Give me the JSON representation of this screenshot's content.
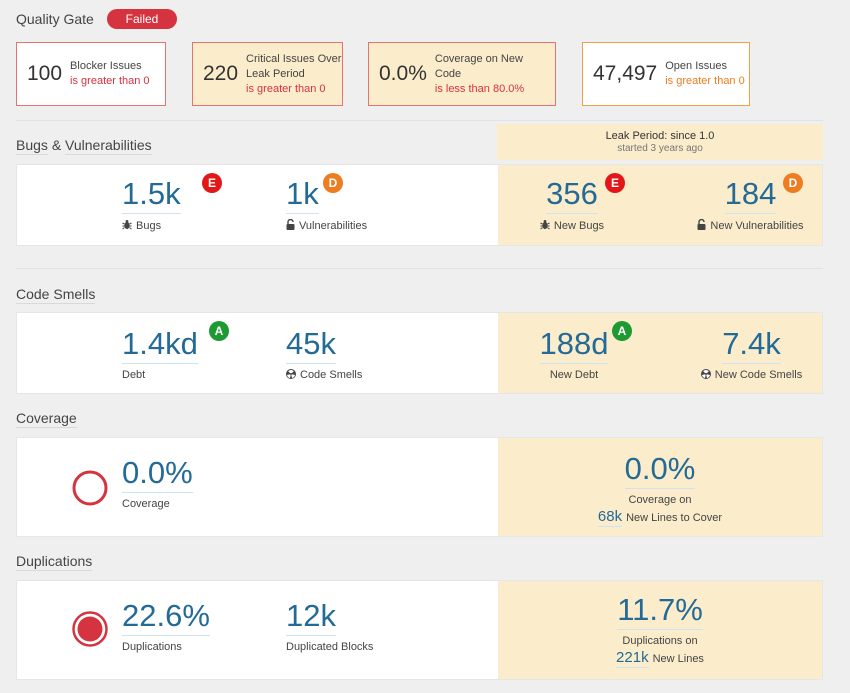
{
  "quality_gate": {
    "title": "Quality Gate",
    "status": "Failed",
    "conditions": [
      {
        "value": "100",
        "label": "Blocker Issues",
        "operator": "is greater than 0",
        "leak": false,
        "level": "error"
      },
      {
        "value": "220",
        "label": "Critical Issues Over Leak Period",
        "operator": "is greater than 0",
        "leak": true,
        "level": "error"
      },
      {
        "value": "0.0%",
        "label": "Coverage on New Code",
        "operator": "is less than 80.0%",
        "leak": true,
        "level": "error"
      },
      {
        "value": "47,497",
        "label": "Open Issues",
        "operator": "is greater than 0",
        "leak": false,
        "level": "warn"
      }
    ]
  },
  "leak_period": {
    "title": "Leak Period: since 1.0",
    "subtitle": "started 3 years ago"
  },
  "bugs_vulnerabilities": {
    "title_part1": "Bugs",
    "title_amp": "&",
    "title_part2": "Vulnerabilities",
    "bugs": {
      "value": "1.5k",
      "label": "Bugs",
      "rating": "E"
    },
    "vulnerabilities": {
      "value": "1k",
      "label": "Vulnerabilities",
      "rating": "D"
    },
    "new_bugs": {
      "value": "356",
      "label": "New Bugs",
      "rating": "E"
    },
    "new_vulnerabilities": {
      "value": "184",
      "label": "New Vulnerabilities",
      "rating": "D"
    }
  },
  "code_smells": {
    "title": "Code Smells",
    "debt": {
      "value": "1.4kd",
      "label": "Debt",
      "rating": "A"
    },
    "smells": {
      "value": "45k",
      "label": "Code Smells"
    },
    "new_debt": {
      "value": "188d",
      "label": "New Debt",
      "rating": "A"
    },
    "new_smells": {
      "value": "7.4k",
      "label": "New Code Smells"
    }
  },
  "coverage": {
    "title": "Coverage",
    "coverage": {
      "value": "0.0%",
      "label": "Coverage",
      "percent": 0
    },
    "new_coverage": {
      "value": "0.0%",
      "label": "Coverage on",
      "lines_value": "68k",
      "lines_label": "New Lines to Cover"
    }
  },
  "duplications": {
    "title": "Duplications",
    "duplications": {
      "value": "22.6%",
      "label": "Duplications",
      "percent": 22.6
    },
    "blocks": {
      "value": "12k",
      "label": "Duplicated Blocks"
    },
    "new_duplications": {
      "value": "11.7%",
      "label": "Duplications on",
      "lines_value": "221k",
      "lines_label": "New Lines"
    }
  },
  "colors": {
    "accent": "#236a97",
    "error": "#d4333f",
    "warn": "#ed7d20",
    "leak_bg": "#fbedcb",
    "rating_E": "#e21717",
    "rating_D": "#ed7d20",
    "rating_A": "#1e9a32"
  }
}
